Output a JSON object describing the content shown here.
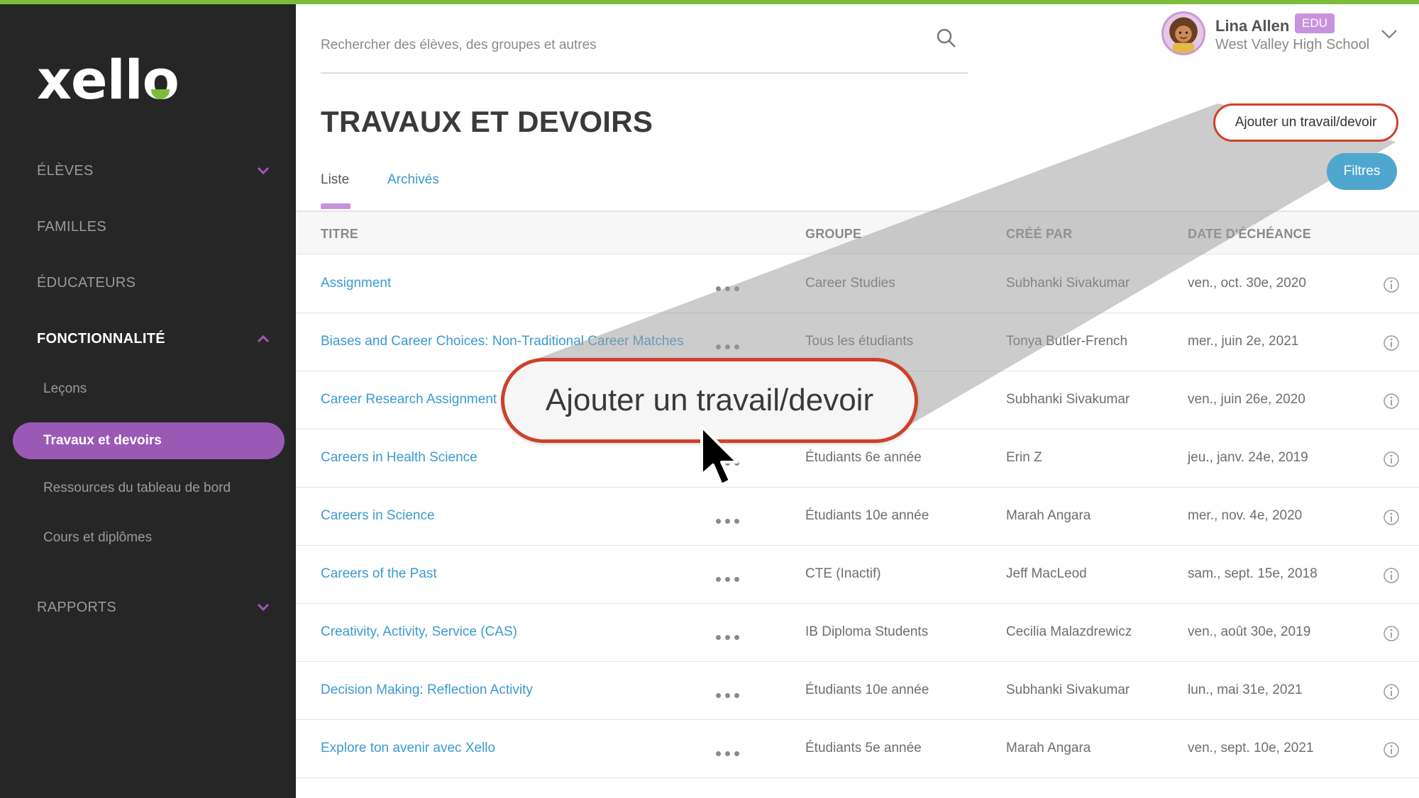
{
  "app": {
    "logo_text": "xello"
  },
  "sidebar": {
    "sections": [
      {
        "label": "ÉLÈVES"
      },
      {
        "label": "FAMILLES"
      },
      {
        "label": "ÉDUCATEURS"
      },
      {
        "label": "FONCTIONNALITÉ"
      },
      {
        "label": "RAPPORTS"
      }
    ],
    "sub_items": [
      {
        "label": "Leçons"
      },
      {
        "label": "Travaux et devoirs"
      },
      {
        "label": "Ressources du tableau de bord"
      },
      {
        "label": "Cours et diplômes"
      }
    ]
  },
  "search": {
    "placeholder": "Rechercher des élèves, des groupes et autres"
  },
  "user": {
    "name": "Lina Allen",
    "badge": "EDU",
    "school": "West Valley High School"
  },
  "page": {
    "title": "TRAVAUX ET DEVOIRS",
    "add_button": "Ajouter un travail/devoir",
    "filters_button": "Filtres",
    "tabs": [
      {
        "label": "Liste"
      },
      {
        "label": "Archivés"
      }
    ]
  },
  "table": {
    "columns": [
      "TITRE",
      "GROUPE",
      "CRÉÉ PAR",
      "DATE D'ÉCHÉANCE"
    ],
    "rows": [
      {
        "title": "Assignment",
        "group": "Career Studies",
        "creator": "Subhanki Sivakumar",
        "due": "ven., oct. 30e, 2020"
      },
      {
        "title": "Biases and Career Choices: Non-Traditional Career Matches",
        "group": "Tous les étudiants",
        "creator": "Tonya Butler-French",
        "due": "mer., juin 2e, 2021"
      },
      {
        "title": "Career Research Assignment",
        "group": "",
        "creator": "Subhanki Sivakumar",
        "due": "ven., juin 26e, 2020"
      },
      {
        "title": "Careers in Health Science",
        "group": "Étudiants 6e année",
        "creator": "Erin Z",
        "due": "jeu., janv. 24e, 2019"
      },
      {
        "title": "Careers in Science",
        "group": "Étudiants 10e année",
        "creator": "Marah Angara",
        "due": "mer., nov. 4e, 2020"
      },
      {
        "title": "Careers of the Past",
        "group": "CTE (Inactif)",
        "creator": "Jeff MacLeod",
        "due": "sam., sept. 15e, 2018"
      },
      {
        "title": "Creativity, Activity, Service (CAS)",
        "group": "IB Diploma Students",
        "creator": "Cecilia Malazdrewicz",
        "due": "ven., août 30e, 2019"
      },
      {
        "title": "Decision Making: Reflection Activity",
        "group": "Étudiants 10e année",
        "creator": "Subhanki Sivakumar",
        "due": "lun., mai 31e, 2021"
      },
      {
        "title": "Explore ton avenir avec Xello",
        "group": "Étudiants 5e année",
        "creator": "Marah Angara",
        "due": "ven., sept. 10e, 2021"
      }
    ]
  },
  "callout": {
    "label": "Ajouter un travail/devoir"
  },
  "colors": {
    "sidebar_bg": "#262626",
    "accent_purple": "#9b59b6",
    "link_blue": "#3b9ad1",
    "highlight_red": "#d0402a",
    "top_green": "#7cbd3c"
  }
}
